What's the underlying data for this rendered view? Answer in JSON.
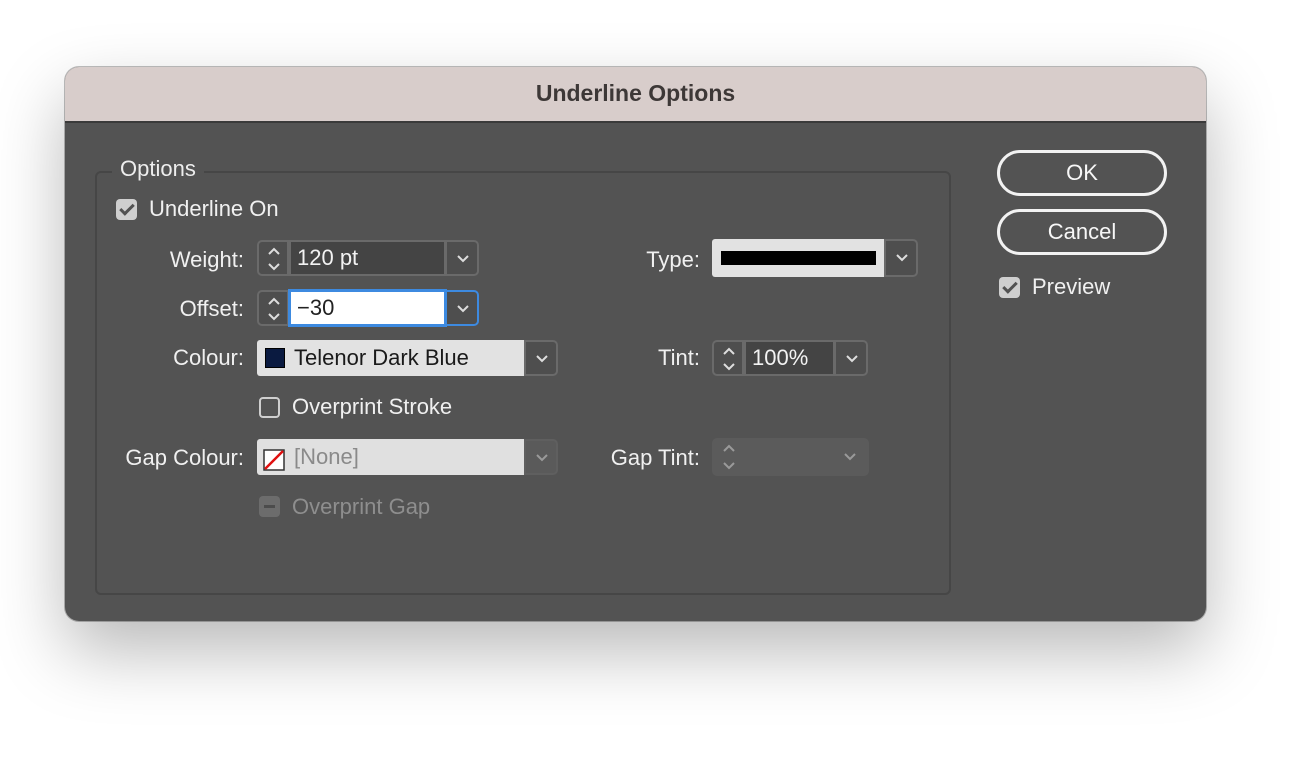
{
  "dialog": {
    "title": "Underline Options",
    "options_group": "Options",
    "underline_on": {
      "label": "Underline On",
      "checked": true
    },
    "weight": {
      "label": "Weight:",
      "value": "120 pt"
    },
    "offset": {
      "label": "Offset:",
      "value": "−30"
    },
    "colour": {
      "label": "Colour:",
      "value": "Telenor Dark Blue",
      "swatch": "#0a1a40"
    },
    "overprint_stroke": {
      "label": "Overprint Stroke",
      "checked": false
    },
    "gap_colour": {
      "label": "Gap Colour:",
      "value": "[None]"
    },
    "overprint_gap": {
      "label": "Overprint Gap",
      "enabled": false
    },
    "type": {
      "label": "Type:"
    },
    "tint": {
      "label": "Tint:",
      "value": "100%"
    },
    "gap_tint": {
      "label": "Gap Tint:",
      "value": ""
    },
    "buttons": {
      "ok": "OK",
      "cancel": "Cancel"
    },
    "preview": {
      "label": "Preview",
      "checked": true
    }
  }
}
